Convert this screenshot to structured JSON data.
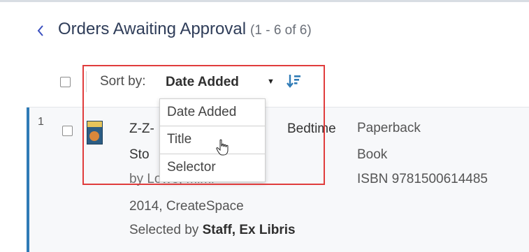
{
  "header": {
    "title": "Orders Awaiting Approval",
    "count": "(1 - 6 of 6)"
  },
  "sort": {
    "label": "Sort by:",
    "selected": "Date Added",
    "options": [
      "Date Added",
      "Title",
      "Selector"
    ]
  },
  "row": {
    "index": "1",
    "title_left": "Z-Z-",
    "title_right": "Bedtime",
    "title_line2": "Sto",
    "author": "by Lowe, Mimi",
    "publication": "2014, CreateSpace",
    "selected_by_prefix": "Selected by",
    "selected_by": "Staff, Ex Libris",
    "format": "Paperback",
    "type": "Book",
    "isbn": "ISBN 9781500614485"
  },
  "colors": {
    "accent": "#2f7bb6",
    "highlight": "#e03c3c",
    "back": "#3a4fbf"
  }
}
